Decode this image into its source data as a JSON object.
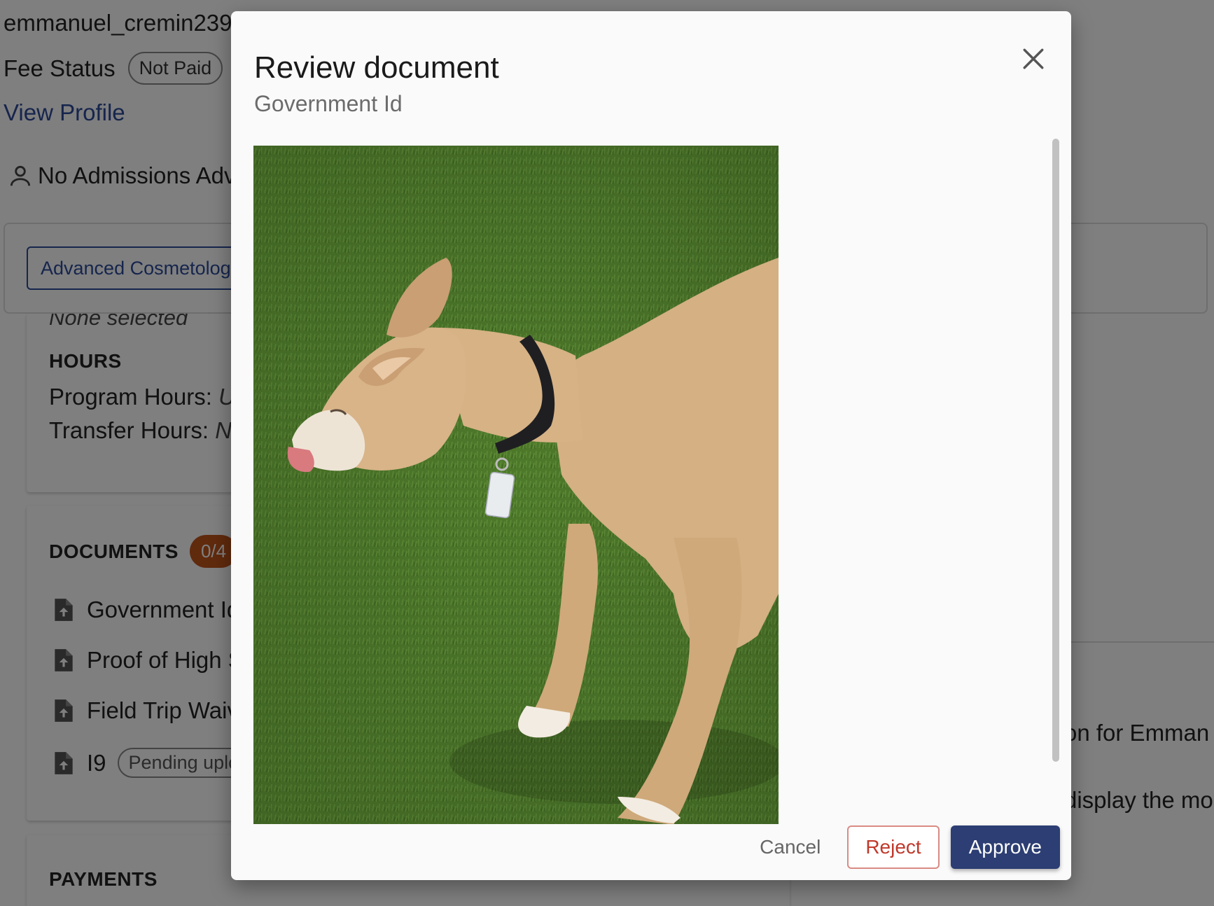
{
  "background": {
    "username": "emmanuel_cremin239",
    "fee_status_label": "Fee Status",
    "fee_status_value": "Not Paid",
    "view_profile": "View Profile",
    "admissions_advisor": "No Admissions Adv",
    "program_tab": "Advanced Cosmetolog",
    "none_selected": "None selected",
    "hours": {
      "title": "HOURS",
      "program_hours_label": "Program Hours:",
      "program_hours_value": "U",
      "transfer_hours_label": "Transfer Hours:",
      "transfer_hours_value": "N"
    },
    "documents": {
      "title": "DOCUMENTS",
      "count": "0/4",
      "items": [
        {
          "label": "Government Id"
        },
        {
          "label": "Proof of High S"
        },
        {
          "label": "Field Trip Waiv"
        },
        {
          "label": "I9",
          "badge": "Pending uplo"
        }
      ]
    },
    "payments_title": "PAYMENTS",
    "right_text_1": "on for Emman",
    "right_text_2": "display the mo"
  },
  "modal": {
    "title": "Review document",
    "subtitle": "Government Id",
    "image_alt": "Photo of a dog with a collar and tag on artificial grass",
    "buttons": {
      "cancel": "Cancel",
      "reject": "Reject",
      "approve": "Approve"
    }
  },
  "colors": {
    "primary": "#2c3e73",
    "link": "#2c4a9b",
    "reject": "#c0392b",
    "badge": "#c0541a"
  }
}
